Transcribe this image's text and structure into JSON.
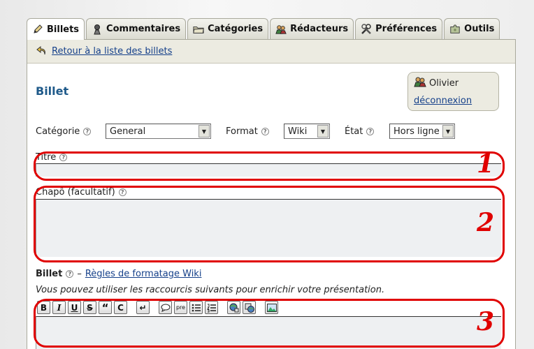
{
  "tabs": [
    {
      "label": "Billets",
      "icon": "pen-icon"
    },
    {
      "label": "Commentaires",
      "icon": "comments-icon"
    },
    {
      "label": "Catégories",
      "icon": "folder-icon"
    },
    {
      "label": "Rédacteurs",
      "icon": "users-icon"
    },
    {
      "label": "Préférences",
      "icon": "tools-icon"
    },
    {
      "label": "Outils",
      "icon": "puzzle-icon"
    }
  ],
  "subbar": {
    "back_link": "Retour à la liste des billets"
  },
  "page": {
    "title": "Billet"
  },
  "user": {
    "name": "Olivier",
    "logout": "déconnexion"
  },
  "filters": {
    "category_label": "Catégorie",
    "category_value": "General",
    "format_label": "Format",
    "format_value": "Wiki",
    "state_label": "État",
    "state_value": "Hors ligne"
  },
  "fields": {
    "title_label": "Titre",
    "chapo_label": "Chapô (facultatif)",
    "billet_label": "Billet",
    "billet_separator": "–",
    "billet_rules_link": "Règles de formatage Wiki",
    "hint": "Vous pouvez utiliser les raccourcis suivants pour enrichir votre présentation."
  },
  "toolbar": {
    "bold": "B",
    "italic": "I",
    "underline": "U",
    "strike": "S",
    "quote": "“",
    "code": "C",
    "br": "↵",
    "pre": "pre"
  },
  "annotations": [
    "1",
    "2",
    "3"
  ],
  "colors": {
    "annotation": "#e00000",
    "link": "#15408a",
    "title": "#1f5a8a",
    "bar": "#ecebe1"
  }
}
